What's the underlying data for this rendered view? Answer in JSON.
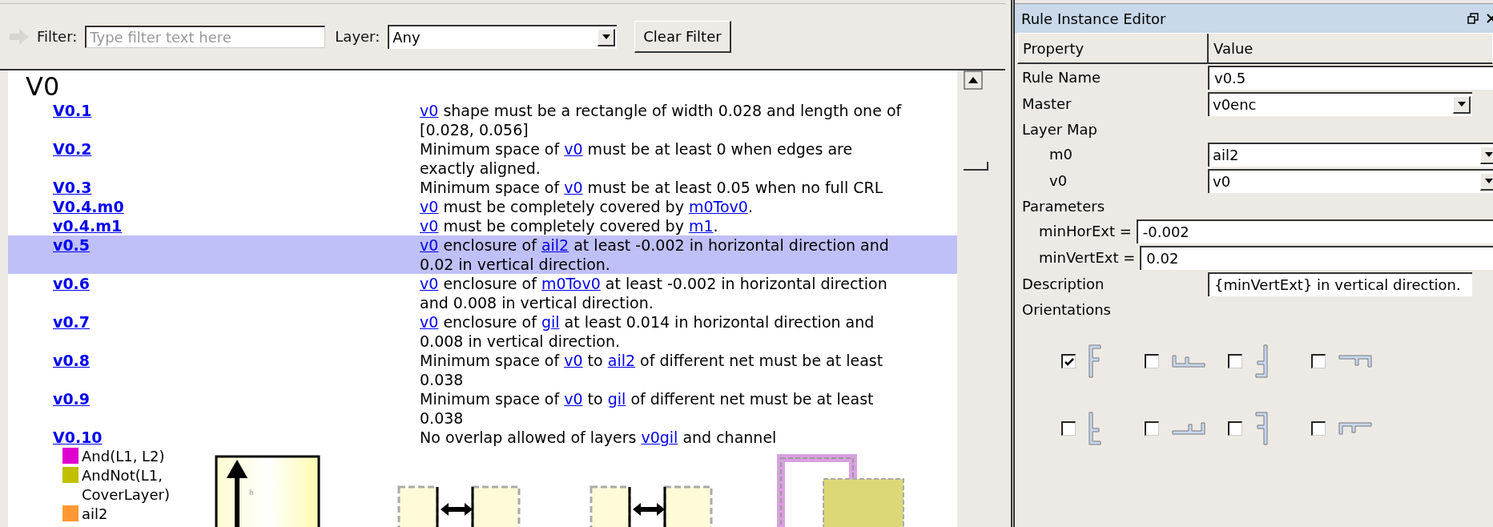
{
  "toolbar": {
    "filter_label": "Filter:",
    "filter_placeholder": "Type filter text here",
    "layer_label": "Layer:",
    "layer_value": "Any",
    "clear_button": "Clear Filter"
  },
  "section_title": "V0",
  "rules": [
    {
      "name": "V0.1",
      "selected": false,
      "description": [
        {
          "text": "v0",
          "kind": "link"
        },
        {
          "text": " shape must be a rectangle of width 0.028 and length one of [0.028, 0.056]",
          "kind": "text"
        }
      ]
    },
    {
      "name": "V0.2",
      "selected": false,
      "description": [
        {
          "text": "Minimum space of ",
          "kind": "text"
        },
        {
          "text": "v0",
          "kind": "link"
        },
        {
          "text": " must be at least 0 when edges are exactly aligned.",
          "kind": "text"
        }
      ]
    },
    {
      "name": "V0.3",
      "selected": false,
      "description": [
        {
          "text": "Minimum space of ",
          "kind": "text"
        },
        {
          "text": "v0",
          "kind": "link"
        },
        {
          "text": " must be at least 0.05 when no full CRL",
          "kind": "text"
        }
      ]
    },
    {
      "name": "V0.4.m0",
      "selected": false,
      "description": [
        {
          "text": "v0",
          "kind": "link"
        },
        {
          "text": " must be completely covered by ",
          "kind": "text"
        },
        {
          "text": "m0Tov0",
          "kind": "link"
        },
        {
          "text": ".",
          "kind": "text"
        }
      ]
    },
    {
      "name": "v0.4.m1",
      "selected": false,
      "description": [
        {
          "text": "v0",
          "kind": "link"
        },
        {
          "text": " must be completely covered by ",
          "kind": "text"
        },
        {
          "text": "m1",
          "kind": "link"
        },
        {
          "text": ".",
          "kind": "text"
        }
      ]
    },
    {
      "name": "v0.5",
      "selected": true,
      "description": [
        {
          "text": "v0",
          "kind": "link"
        },
        {
          "text": " enclosure of ",
          "kind": "text"
        },
        {
          "text": "ail2",
          "kind": "link"
        },
        {
          "text": " at least -0.002 in horizontal direction and 0.02 in vertical direction.",
          "kind": "text"
        }
      ]
    },
    {
      "name": "v0.6",
      "selected": false,
      "description": [
        {
          "text": "v0",
          "kind": "link"
        },
        {
          "text": " enclosure of ",
          "kind": "text"
        },
        {
          "text": "m0Tov0",
          "kind": "link"
        },
        {
          "text": " at least -0.002 in horizontal direction and 0.008 in vertical direction.",
          "kind": "text"
        }
      ]
    },
    {
      "name": "v0.7",
      "selected": false,
      "description": [
        {
          "text": "v0",
          "kind": "link"
        },
        {
          "text": " enclosure of ",
          "kind": "text"
        },
        {
          "text": "gil",
          "kind": "link"
        },
        {
          "text": " at least 0.014 in horizontal direction and 0.008 in vertical direction.",
          "kind": "text"
        }
      ]
    },
    {
      "name": "v0.8",
      "selected": false,
      "description": [
        {
          "text": "Minimum space of ",
          "kind": "text"
        },
        {
          "text": "v0",
          "kind": "link"
        },
        {
          "text": " to ",
          "kind": "text"
        },
        {
          "text": "ail2",
          "kind": "link"
        },
        {
          "text": " of different net must be at least 0.038",
          "kind": "text"
        }
      ]
    },
    {
      "name": "v0.9",
      "selected": false,
      "description": [
        {
          "text": "Minimum space of ",
          "kind": "text"
        },
        {
          "text": "v0",
          "kind": "link"
        },
        {
          "text": " to ",
          "kind": "text"
        },
        {
          "text": "gil",
          "kind": "link"
        },
        {
          "text": " of different net must be at least 0.038",
          "kind": "text"
        }
      ]
    },
    {
      "name": "V0.10",
      "selected": false,
      "description": [
        {
          "text": "No overlap allowed of layers ",
          "kind": "text"
        },
        {
          "text": "v0gil",
          "kind": "link"
        },
        {
          "text": " and channel",
          "kind": "text"
        }
      ]
    }
  ],
  "legend": [
    {
      "label": "And(L1, L2)",
      "color": "#e000d0"
    },
    {
      "label": "AndNot(L1, CoverLayer)",
      "color": "#c0c000"
    },
    {
      "label": "ail2",
      "color": "#ff9933"
    }
  ],
  "diagram_label": "h",
  "editor": {
    "title": "Rule Instance Editor",
    "columns": [
      "Property",
      "Value"
    ],
    "rows": [
      {
        "kind": "text",
        "label": "Rule Name",
        "value": "v0.5"
      },
      {
        "kind": "combo",
        "label": "Master",
        "value": "v0enc"
      },
      {
        "kind": "group",
        "label": "Layer Map",
        "children": [
          {
            "kind": "combo",
            "label": "m0",
            "value": "ail2"
          },
          {
            "kind": "combo",
            "label": "v0",
            "value": "v0"
          }
        ]
      },
      {
        "kind": "group",
        "label": "Parameters",
        "children": [
          {
            "kind": "param",
            "label": "minHorExt =",
            "value": "-0.002"
          },
          {
            "kind": "param",
            "label": "minVertExt =",
            "value": "0.02"
          }
        ]
      },
      {
        "kind": "text",
        "label": "Description",
        "value": "{minVertExt} in vertical direction."
      },
      {
        "kind": "orientations",
        "label": "Orientations",
        "options": [
          {
            "checked": true
          },
          {
            "checked": false
          },
          {
            "checked": false
          },
          {
            "checked": false
          },
          {
            "checked": false
          },
          {
            "checked": false
          },
          {
            "checked": false
          },
          {
            "checked": false
          }
        ]
      }
    ]
  }
}
